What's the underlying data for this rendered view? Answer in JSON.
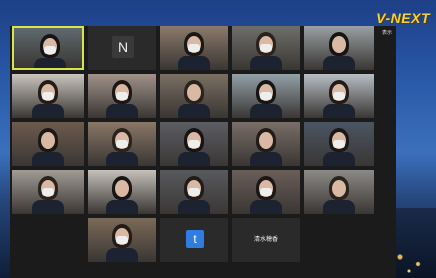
{
  "desktop": {
    "logo": "V-NEXT"
  },
  "window": {
    "view_label": "表示"
  },
  "grid": {
    "tiles": [
      {
        "kind": "video",
        "active": true,
        "bg": "#5f6a6e"
      },
      {
        "kind": "letter",
        "letter": "N"
      },
      {
        "kind": "video",
        "bg": "#8c7a6a"
      },
      {
        "kind": "video",
        "bg": "#6f6f6a"
      },
      {
        "kind": "video",
        "bg": "#9aa0a3"
      },
      {
        "kind": "video",
        "bg": "#c9c5bd"
      },
      {
        "kind": "video",
        "bg": "#a1928a"
      },
      {
        "kind": "video",
        "bg": "#7a6f62"
      },
      {
        "kind": "video",
        "bg": "#93a1a8"
      },
      {
        "kind": "video",
        "bg": "#b8bec4"
      },
      {
        "kind": "video",
        "bg": "#6c5b4d"
      },
      {
        "kind": "video",
        "bg": "#8a7767"
      },
      {
        "kind": "video",
        "bg": "#5c5d63"
      },
      {
        "kind": "video",
        "bg": "#7a6e67"
      },
      {
        "kind": "video",
        "bg": "#4b5563"
      },
      {
        "kind": "video",
        "bg": "#a19b95"
      },
      {
        "kind": "video",
        "bg": "#c5c0b8"
      },
      {
        "kind": "video",
        "bg": "#585a5e"
      },
      {
        "kind": "video",
        "bg": "#6a5e58"
      },
      {
        "kind": "video",
        "bg": "#8c8a87"
      },
      {
        "kind": "empty"
      },
      {
        "kind": "video",
        "bg": "#7b6a58"
      },
      {
        "kind": "letter_t",
        "letter": "t"
      },
      {
        "kind": "name",
        "name": "清水穂香"
      }
    ]
  }
}
